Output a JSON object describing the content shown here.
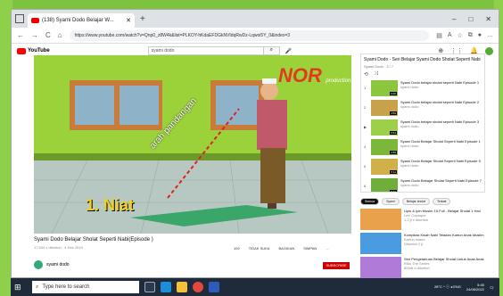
{
  "browser": {
    "tab_title": "(138) Syami Dodo Belajar W...",
    "new_tab": "+",
    "window_controls": [
      "–",
      "□",
      "✕"
    ],
    "url": "https://www.youtube.com/watch?v=Qnp0_z8W4k&list=PLKOY-hKdaEFDGkNVIdqRwDz-Lqwoi5Y_0&index=3",
    "nav": [
      "←",
      "→",
      "C",
      "⌂"
    ]
  },
  "youtube": {
    "logo_text": "YouTube",
    "search_value": "syami dodo",
    "search_icon": "search-icon"
  },
  "video": {
    "logo_text": "NOR",
    "logo_sub": "production",
    "overlay_direction": "arah pandangan",
    "overlay_step": "1. Niat",
    "title": "Syami Dodo Belajar Sholat Seperti Nabi(Episode )",
    "meta": "17.544 x ditonton · 4 Des 2019",
    "actions": [
      "192",
      "TIDAK SUKA",
      "BAGIKAN",
      "SIMPAN",
      "..."
    ],
    "channel": "syami dodo",
    "subscribe": "SUBSCRIBE"
  },
  "playlist": {
    "title": "Syami Dodo - Seri Belajar Syami Dodo Sholat Seperti Nabi",
    "meta": "Syami Dodo · 3 / 7",
    "items": [
      {
        "idx": "1",
        "title": "Syami Dodo belajar sholat seperti Nabi Episode 1",
        "channel": "syami dodo",
        "duration": "6:00"
      },
      {
        "idx": "2",
        "title": "Syami Dodo belajar sholat seperti Nabi Episode 2",
        "channel": "syami dodo",
        "duration": "4:59"
      },
      {
        "idx": "▶",
        "title": "Syami Dodo belajar sholat seperti Nabi Episode 3",
        "channel": "syami dodo",
        "duration": "5:54"
      },
      {
        "idx": "4",
        "title": "Syami Dodo Belajar Sholat Seperti Nabi Episode 1",
        "channel": "syami dodo",
        "duration": "4:59"
      },
      {
        "idx": "5",
        "title": "Syami Dodo Belajar Sholat Seperti Nabi Episode 5",
        "channel": "syami dodo",
        "duration": "5:11"
      },
      {
        "idx": "6",
        "title": "Syami Dodo Bekajar Sholat Seperti Nabi Episode 7",
        "channel": "syami dodo",
        "duration": "5:32"
      }
    ]
  },
  "chips": [
    "Semua",
    "Syami",
    "Belajar sholat",
    "Terkait"
  ],
  "recommended": [
    {
      "title": "Upin & Ipin Musim 15 Full - Belajar Sholat 1 Hari",
      "channel": "Les' Copaque",
      "meta": "1,2 jt x ditonton"
    },
    {
      "title": "Kompilasi Kisah Nabi Teladan Kartun Anak Muslim",
      "channel": "Kartun Islami",
      "meta": "Ditonton 2 jt"
    },
    {
      "title": "Seri Pengetahuan Belajar Sholat Untuk Anak Anak",
      "channel": "Riko The Series",
      "meta": "800rb x ditonton"
    }
  ],
  "taskbar": {
    "search_placeholder": "Type here to search",
    "time": "5:45",
    "date": "24/06/2022",
    "tray": "28°C ^ ⓘ ◂ ENG"
  }
}
